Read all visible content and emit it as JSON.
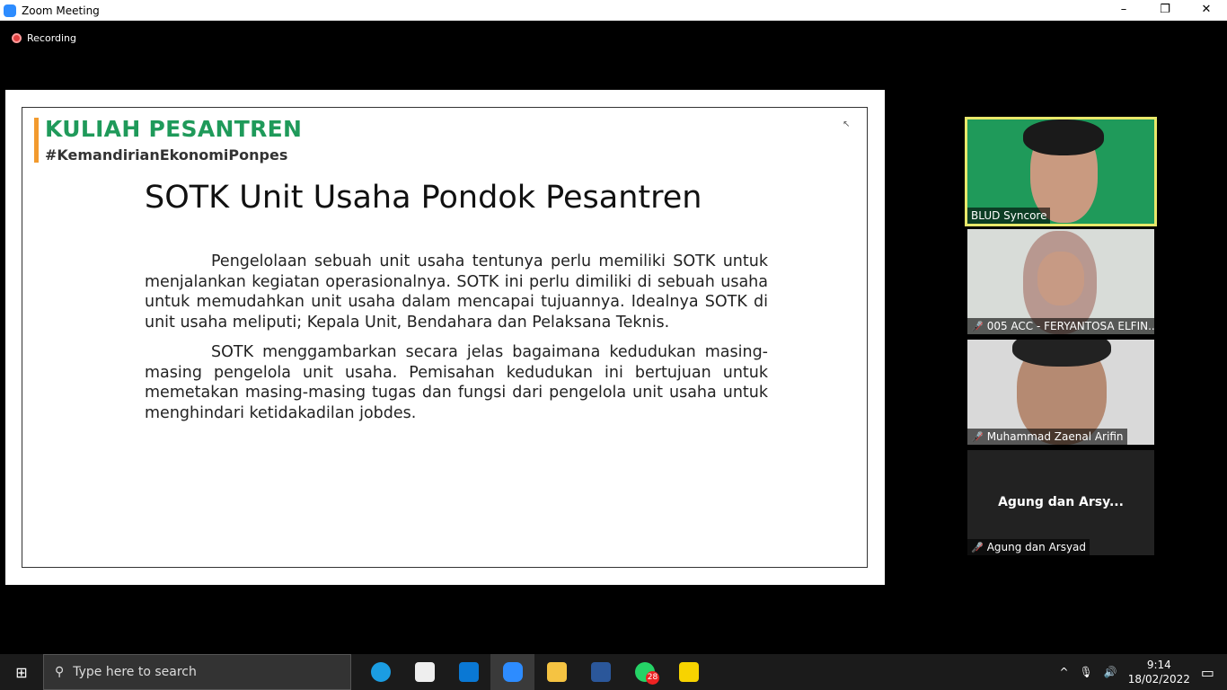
{
  "window": {
    "title": "Zoom Meeting",
    "minimize": "–",
    "restore": "❐",
    "close": "✕"
  },
  "recording": "Recording",
  "slide": {
    "brand": "KULIAH PESANTREN",
    "hashtag": "#KemandirianEkonomiPonpes",
    "heading": "SOTK Unit Usaha Pondok Pesantren",
    "paragraphs": [
      "Pengelolaan sebuah unit usaha tentunya perlu memiliki SOTK untuk menjalankan kegiatan operasionalnya. SOTK ini perlu dimiliki di sebuah usaha untuk memudahkan unit usaha dalam mencapai tujuannya. Idealnya SOTK di unit usaha meliputi; Kepala Unit, Bendahara dan Pelaksana Teknis.",
      "SOTK menggambarkan secara jelas bagaimana kedudukan masing-masing pengelola unit usaha. Pemisahan kedudukan ini bertujuan untuk memetakan masing-masing tugas dan fungsi dari pengelola unit usaha untuk menghindari ketidakadilan jobdes."
    ]
  },
  "participants": [
    {
      "name": "BLUD Syncore",
      "muted": false,
      "active_speaker": true
    },
    {
      "name": "005 ACC - FERYANTOSA ELFIN...",
      "muted": true
    },
    {
      "name": "Muhammad Zaenal Arifin",
      "muted": true
    },
    {
      "name": "Agung dan Arsyad",
      "display": "Agung dan Arsy...",
      "muted": true,
      "video": false
    }
  ],
  "taskbar": {
    "search_placeholder": "Type here to search",
    "apps": [
      "edge",
      "store",
      "mail",
      "zoom",
      "file-explorer",
      "word",
      "whatsapp",
      "sticky-notes"
    ],
    "whatsapp_badge": "28",
    "time": "9:14",
    "date": "18/02/2022"
  }
}
